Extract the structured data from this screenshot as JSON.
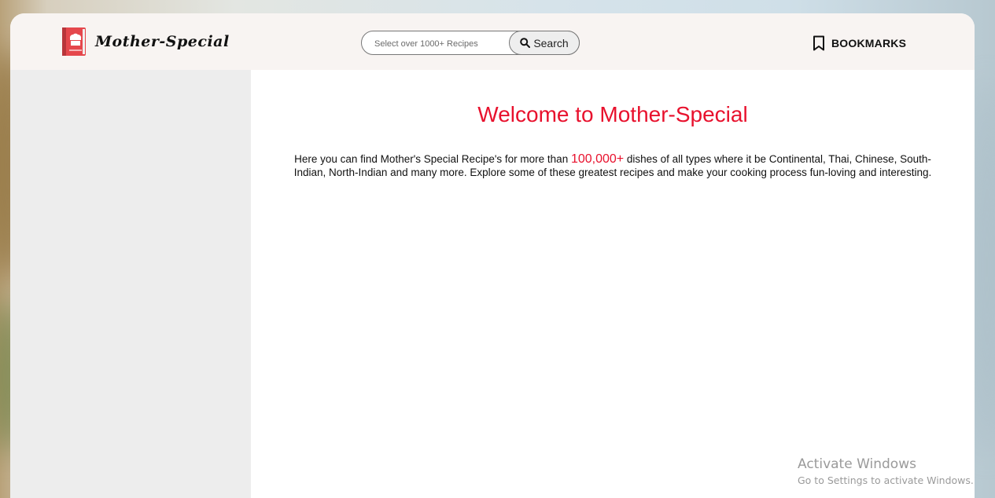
{
  "header": {
    "logo_text": "Mother-Special",
    "search": {
      "placeholder": "Select over 1000+ Recipes",
      "button_label": "Search"
    },
    "bookmarks_label": "BOOKMARKS"
  },
  "main": {
    "title": "Welcome to Mother-Special",
    "intro_before": "Here you can find Mother's Special Recipe's for more than ",
    "intro_highlight": "100,000+",
    "intro_after": " dishes of all types where it be Continental, Thai, Chinese, South-Indian, North-Indian and many more. Explore some of these greatest recipes and make your cooking process fun-loving and interesting."
  },
  "os_watermark": {
    "title": "Activate Windows",
    "subtitle": "Go to Settings to activate Windows."
  },
  "colors": {
    "accent": "#e8112d",
    "header_bg": "#f8f4f2",
    "sidebar_bg": "#ededed"
  },
  "icons": {
    "logo": "recipe-book-icon",
    "search": "magnifier-icon",
    "bookmarks": "bookmark-icon"
  }
}
